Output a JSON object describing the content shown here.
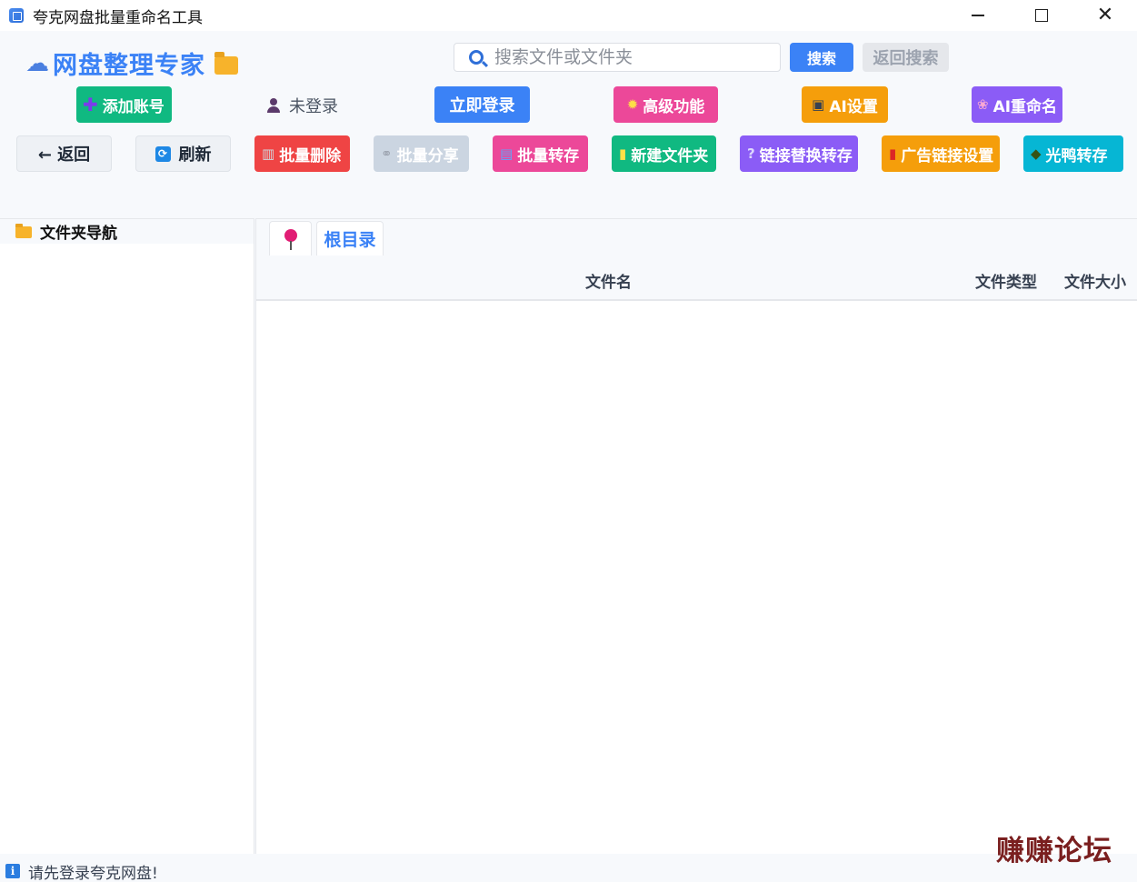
{
  "window": {
    "title": "夸克网盘批量重命名工具"
  },
  "brand": {
    "title": "网盘整理专家"
  },
  "search": {
    "placeholder": "搜索文件或文件夹",
    "button_label": "搜索",
    "back_label": "返回搜索"
  },
  "account": {
    "status": "未登录"
  },
  "toolbar_top": {
    "add_account": "添加账号",
    "login_now": "立即登录",
    "advanced": "高级功能",
    "ai_settings": "AI设置",
    "ai_rename": "AI重命名"
  },
  "toolbar_bottom": {
    "back": "← 返回",
    "refresh": "刷新",
    "batch_delete": "批量删除",
    "batch_share": "批量分享",
    "batch_transfer": "批量转存",
    "new_folder": "新建文件夹",
    "link_replace": "链接替换转存",
    "ad_link": "广告链接设置",
    "duck_transfer": "光鸭转存"
  },
  "folder_nav": {
    "title": "文件夹导航"
  },
  "breadcrumb": {
    "root": "根目录"
  },
  "table": {
    "columns": [
      "文件名",
      "文件类型",
      "文件大小"
    ]
  },
  "statusbar": {
    "message": "请先登录夸克网盘!"
  },
  "watermark": {
    "text": "赚赚论坛"
  },
  "colors": {
    "accent": "#3b82f6",
    "green": "#10b981",
    "pink": "#ec4899",
    "orange": "#f59e0b",
    "purple": "#8b5cf6",
    "red": "#ef4444",
    "cyan": "#06b6d4"
  }
}
